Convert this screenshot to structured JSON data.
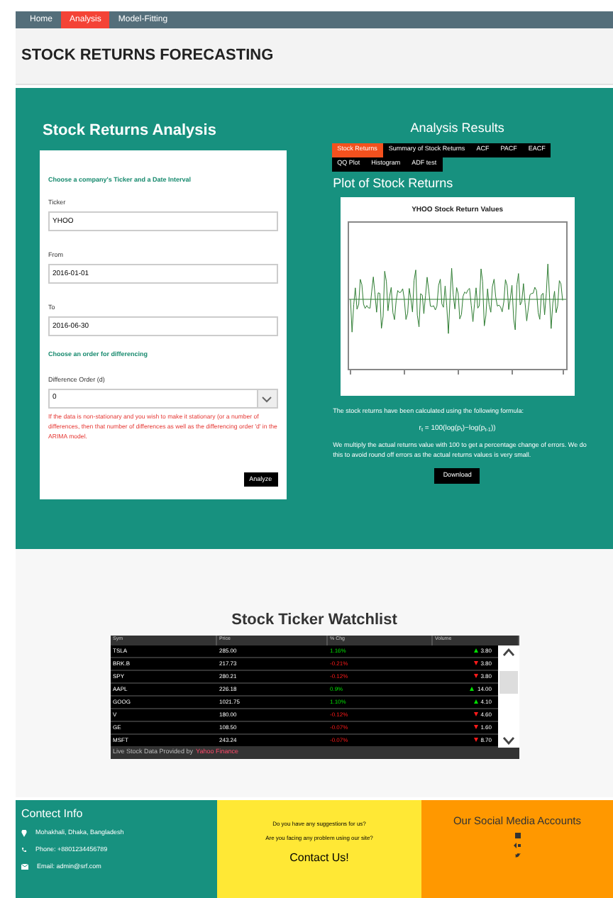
{
  "nav": [
    {
      "label": "Home",
      "selected": false
    },
    {
      "label": "Analysis",
      "selected": true
    },
    {
      "label": "Model-Fitting",
      "selected": false
    }
  ],
  "title": "STOCK RETURNS FORECASTING",
  "analysis_form": {
    "heading": "Stock Returns Analysis",
    "section_1": "Choose a company's Ticker and a Date Interval",
    "fields": [
      {
        "label": "Ticker",
        "value": "YHOO"
      },
      {
        "label": "From",
        "value": "2016-01-01"
      },
      {
        "label": "To",
        "value": "2016-06-30"
      }
    ],
    "section_2": "Choose an order for differencing",
    "select": {
      "label": "Difference Order (d)",
      "value": "0"
    },
    "note": "If the data is non-stationary and you wish to make it stationary (or a number of differences, then that number of differences as well as the differencing order 'd' in the ARIMA model.",
    "button": "Analyze"
  },
  "results": {
    "heading": "Analysis Results",
    "tabs": [
      {
        "label": "Stock Returns",
        "selected": true
      },
      {
        "label": "Summary of Stock Returns",
        "selected": false
      },
      {
        "label": "ACF",
        "selected": false
      },
      {
        "label": "PACF",
        "selected": false
      },
      {
        "label": "EACF",
        "selected": false
      },
      {
        "label": "QQ Plot",
        "selected": false
      },
      {
        "label": "Histogram",
        "selected": false
      },
      {
        "label": "ADF test",
        "selected": false
      }
    ],
    "plot_heading": "Plot of Stock Returns",
    "plot_title": "YHOO Stock Return Values",
    "text_1": "The stock returns have been calculated using the following formula:",
    "formula": "r$_{t}$ = 100(log(p$_{t}$)−log(p$_{t-1}$))",
    "text_2": "We multiply the actual returns value with 100 to get a percentage change of errors. We do this to avoid round off errors as the actual returns values is very small.",
    "button": "Download"
  },
  "watchlist": {
    "title": "Stock Ticker Watchlist",
    "columns": [
      "Sym",
      "Price",
      "% Chg",
      "Volume"
    ],
    "rows": [
      {
        "cells": [
          "TSLA",
          "285.00",
          "1.16%",
          "3.80"
        ],
        "rising": true
      },
      {
        "cells": [
          "BRK.B",
          "217.73",
          "-0.21%",
          "3.80"
        ],
        "rising": false
      },
      {
        "cells": [
          "SPY",
          "280.21",
          "-0.12%",
          "3.80"
        ],
        "rising": false
      },
      {
        "cells": [
          "AAPL",
          "226.18",
          "0.9%",
          "14.00"
        ],
        "rising": true
      },
      {
        "cells": [
          "GOOG",
          "1021.75",
          "1.10%",
          "4.10"
        ],
        "rising": true
      },
      {
        "cells": [
          "V",
          "180.00",
          "-0.12%",
          "4.60"
        ],
        "rising": false
      },
      {
        "cells": [
          "GE",
          "108.50",
          "-0.07%",
          "1.60"
        ],
        "rising": false
      },
      {
        "cells": [
          "MSFT",
          "243.24",
          "-0.07%",
          "8.70"
        ],
        "rising": false
      }
    ],
    "footer_text": "Live Stock Data Provided by",
    "footer_link": "Yahoo Finance"
  },
  "footer": {
    "contact": {
      "heading": "Contect Info",
      "items": [
        {
          "kind": "location",
          "text": "Mohakhali, Dhaka, Bangladesh"
        },
        {
          "kind": "phone",
          "text": "Phone: +8801234456789"
        },
        {
          "kind": "email",
          "text": "Email: admin@srf.com"
        }
      ]
    },
    "suggestions": {
      "lines": [
        "Do you have any suggestions for us?",
        "Are you facing any problem using our site?"
      ],
      "button": "Contact Us!"
    },
    "social": {
      "heading": "Our Social Media Accounts"
    }
  }
}
